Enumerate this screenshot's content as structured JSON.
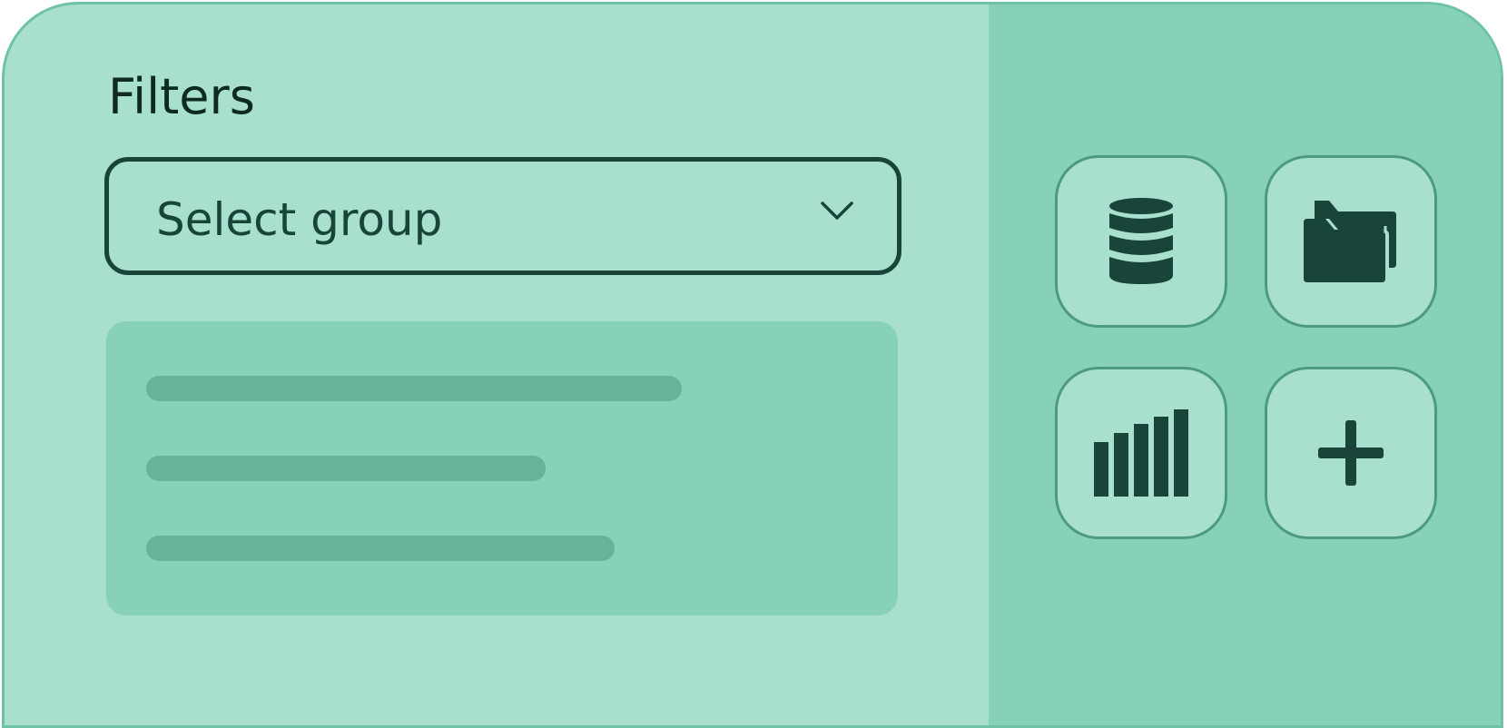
{
  "filters": {
    "title": "Filters",
    "group_select": {
      "value": "Select group"
    }
  },
  "actions": {
    "icons": [
      "database-icon",
      "folder-icon",
      "bar-chart-icon",
      "plus-icon"
    ]
  },
  "colors": {
    "background": "#a8dfcd",
    "right_pane": "#87d1b8",
    "accent_dark": "#18443a",
    "skeleton": "#65b39a",
    "tile_border": "#4c9a82"
  }
}
